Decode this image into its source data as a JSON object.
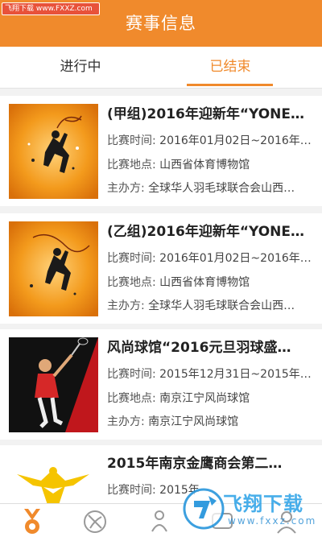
{
  "watermark_top": "飞翔下载 www.FXXZ.com",
  "header": {
    "title": "赛事信息"
  },
  "tabs": [
    {
      "label": "进行中",
      "active": false
    },
    {
      "label": "已结束",
      "active": true
    }
  ],
  "events": [
    {
      "title": "(甲组)2016年迎新年“YONE…",
      "time_label": "比赛时间:",
      "time": "2016年01月02日~2016年…",
      "place_label": "比赛地点:",
      "place": "山西省体育博物馆",
      "organizer_label": "主办方:",
      "organizer": "全球华人羽毛球联合会山西…"
    },
    {
      "title": "(乙组)2016年迎新年“YONE…",
      "time_label": "比赛时间:",
      "time": "2016年01月02日~2016年…",
      "place_label": "比赛地点:",
      "place": "山西省体育博物馆",
      "organizer_label": "主办方:",
      "organizer": "全球华人羽毛球联合会山西…"
    },
    {
      "title": "风尚球馆“2016元旦羽球盛…",
      "time_label": "比赛时间:",
      "time": "2015年12月31日~2015年…",
      "place_label": "比赛地点:",
      "place": "南京江宁风尚球馆",
      "organizer_label": "主办方:",
      "organizer": "南京江宁风尚球馆"
    },
    {
      "title": "2015年南京金鹰商会第二…",
      "time_label": "比赛时间:",
      "time": "2015年",
      "place_label": "",
      "place": "",
      "organizer_label": "",
      "organizer": ""
    }
  ],
  "watermark_logo": {
    "text": "飞翔下载",
    "url": "www.fxxz.com"
  },
  "colors": {
    "accent": "#f08a2c",
    "card_bg": "#ffffff",
    "page_bg": "#f2f2f2"
  },
  "bottom_nav": [
    "medal-icon",
    "badminton-ball-icon",
    "players-icon",
    "chat-icon",
    "profile-icon"
  ]
}
